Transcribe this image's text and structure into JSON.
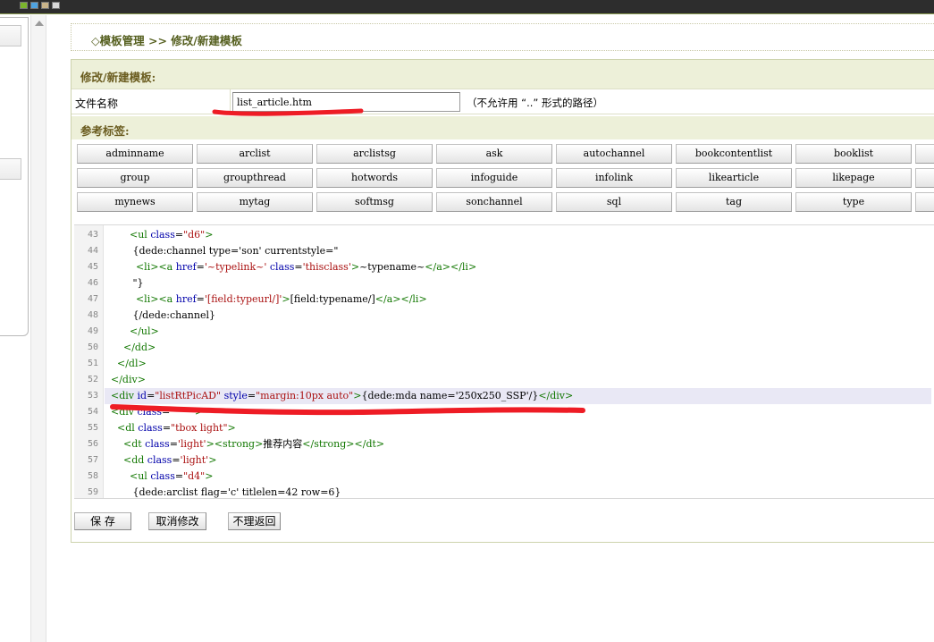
{
  "breadcrumb": "◇模板管理 >> 修改/新建模板",
  "form": {
    "section_title": "修改/新建模板:",
    "file_label": "文件名称",
    "file_value": "list_article.htm",
    "file_hint": "（不允许用 “..” 形式的路径）",
    "tags_title": "参考标签:"
  },
  "tags": [
    "adminname",
    "arclist",
    "arclistsg",
    "ask",
    "autochannel",
    "booklist",
    "booklist",
    "group",
    "groupthread",
    "hotwords",
    "infoguide",
    "infolink",
    "likearticle",
    "likepage",
    "mynews",
    "mytag",
    "softmsg",
    "sonchannel",
    "sql",
    "tag",
    "type"
  ],
  "tags_override": {
    "5": "bookcontentlist"
  },
  "code": {
    "line_numbers": [
      "43",
      "44",
      "45",
      "46",
      "47",
      "48",
      "49",
      "50",
      "51",
      "52",
      "53",
      "54",
      "55",
      "56",
      "57",
      "58",
      "59"
    ],
    "lines": [
      "        <ul class=\"d6\">",
      "         {dede:channel type='son' currentstyle=\"",
      "          <li><a href='~typelink~' class='thisclass'>~typename~</a></li>",
      "         \"}",
      "          <li><a href='[field:typeurl/]'>[field:typename/]</a></li>",
      "         {/dede:channel}",
      "        </ul>",
      "      </dd>",
      "    </dl>",
      "  </div>",
      "  <div id=\"listRtPicAD\" style=\"margin:10px auto\">{dede:mda name='250x250_SSP'/}</div>",
      "  <div class=\"     \">",
      "    <dl class=\"tbox light\">",
      "      <dt class='light'><strong>推荐内容</strong></dt>",
      "      <dd class='light'>",
      "        <ul class=\"d4\">",
      "         {dede:arclist flag='c' titlelen=42 row=6}"
    ]
  },
  "buttons": {
    "save": "保 存",
    "cancel": "取消修改",
    "back": "不理返回"
  },
  "colors": {
    "annotation": "#ee1c25",
    "band": "#edf0d9",
    "breadcrumb_text": "#555f1f"
  }
}
